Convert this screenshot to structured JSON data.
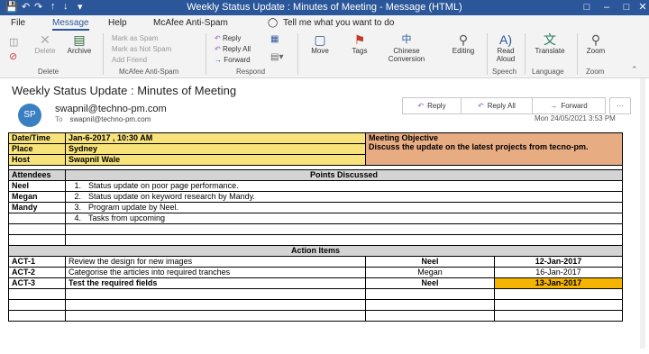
{
  "window": {
    "title": "Weekly Status Update : Minutes of Meeting  -  Message (HTML)"
  },
  "menu": {
    "file": "File",
    "message": "Message",
    "help": "Help",
    "mcafee": "McAfee Anti-Spam",
    "tell": "Tell me what you want to do"
  },
  "ribbon": {
    "delete_label": "Delete",
    "archive_label": "Archive",
    "group_delete": "Delete",
    "mark_spam": "Mark as Spam",
    "mark_not_spam": "Mark as Not Spam",
    "add_friend": "Add Friend",
    "group_mcafee": "McAfee Anti-Spam",
    "reply": "Reply",
    "reply_all": "Reply All",
    "forward": "Forward",
    "group_respond": "Respond",
    "move": "Move",
    "tags": "Tags",
    "chinese1": "Chinese",
    "chinese2": "Conversion",
    "editing": "Editing",
    "read1": "Read",
    "read2": "Aloud",
    "group_speech": "Speech",
    "translate": "Translate",
    "group_language": "Language",
    "zoom": "Zoom",
    "group_zoom": "Zoom"
  },
  "message": {
    "subject": "Weekly Status Update : Minutes of Meeting",
    "avatar": "SP",
    "from": "swapnil@techno-pm.com",
    "to_label": "To",
    "to": "swapnil@techno-pm.com",
    "reply": "Reply",
    "reply_all": "Reply All",
    "forward": "Forward",
    "more": "···",
    "date": "Mon 24/05/2021 3:53 PM"
  },
  "minutes": {
    "datetime_label": "Date/Time",
    "datetime": "Jan-6-2017 , 10:30 AM",
    "place_label": "Place",
    "place": "Sydney",
    "host_label": "Host",
    "host": "Swapnil Wale",
    "objective_label": "Meeting Objective",
    "objective": "Discuss the update on the latest projects from tecno-pm.",
    "attendees_label": "Attendees",
    "points_label": "Points Discussed",
    "attendees": [
      "Neel",
      "Megan",
      "Mandy",
      "",
      ""
    ],
    "points": [
      {
        "n": "1.",
        "text": "Status update on poor page performance."
      },
      {
        "n": "2.",
        "text": "Status update on keyword research by Mandy."
      },
      {
        "n": "3.",
        "text": "Program update by Neel."
      },
      {
        "n": "4.",
        "text": "Tasks from upcoming"
      }
    ],
    "action_items_label": "Action Items",
    "actions": [
      {
        "id": "ACT-1",
        "task": "Review the design for new images",
        "owner": "Neel",
        "date": "12-Jan-2017"
      },
      {
        "id": "ACT-2",
        "task": "Categorise the articles into required tranches",
        "owner": "Megan",
        "date": "16-Jan-2017"
      },
      {
        "id": "ACT-3",
        "task": "Test the required fields",
        "owner": "Neel",
        "date": "13-Jan-2017"
      }
    ]
  }
}
